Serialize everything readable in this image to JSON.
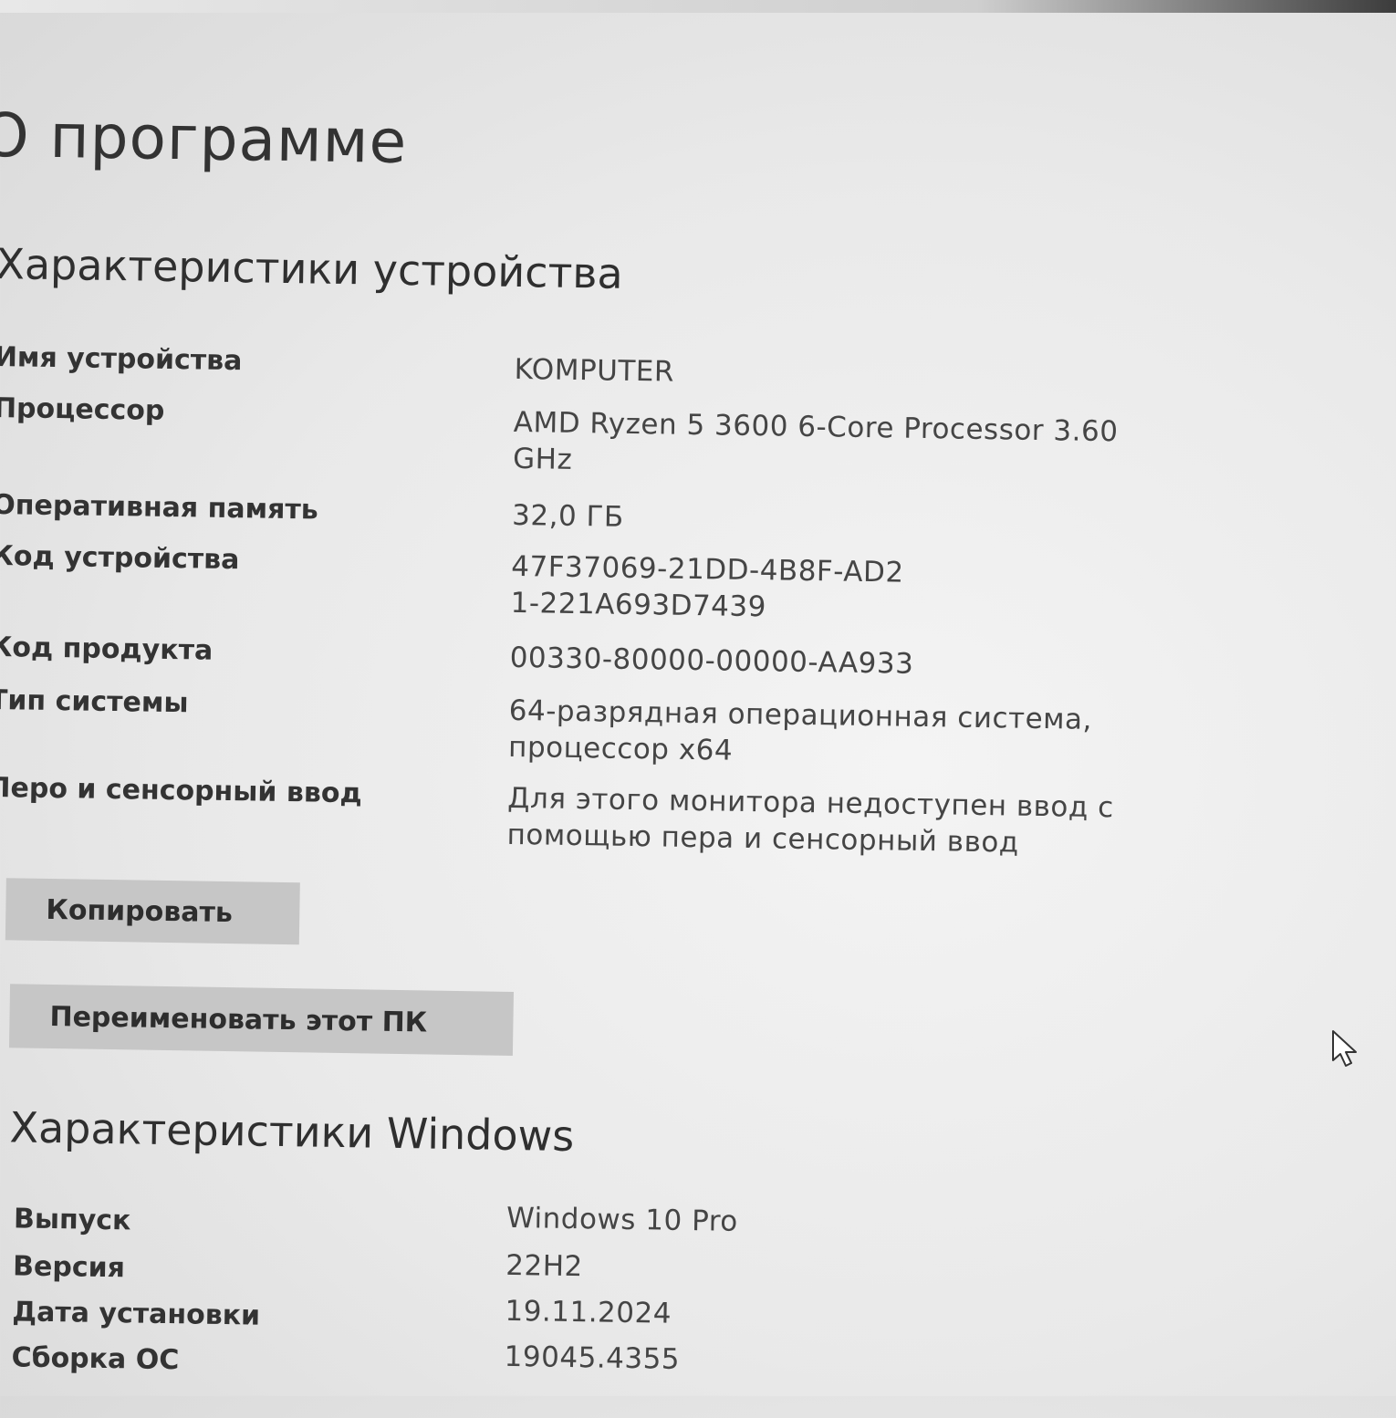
{
  "page": {
    "title": "О программе"
  },
  "device_specs": {
    "title": "Характеристики устройства",
    "rows": [
      {
        "label": "Имя устройства",
        "value": "KOMPUTER"
      },
      {
        "label": "Процессор",
        "value": "AMD Ryzen 5 3600 6-Core Processor 3.60 GHz"
      },
      {
        "label": "Оперативная память",
        "value": "32,0 ГБ"
      },
      {
        "label": "Код устройства",
        "value": "47F37069-21DD-4B8F-AD21-221A693D7439"
      },
      {
        "label": "Код продукта",
        "value": "00330-80000-00000-AA933"
      },
      {
        "label": "Тип системы",
        "value": "64-разрядная операционная система, процессор x64"
      },
      {
        "label": "Перо и сенсорный ввод",
        "value": "Для этого монитора недоступен ввод с помощью пера и сенсорный ввод"
      }
    ],
    "copy_button": "Копировать",
    "rename_button": "Переименовать этот ПК"
  },
  "windows_specs": {
    "title": "Характеристики Windows",
    "rows": [
      {
        "label": "Выпуск",
        "value": "Windows 10 Pro"
      },
      {
        "label": "Версия",
        "value": "22H2"
      },
      {
        "label": "Дата установки",
        "value": "19.11.2024"
      },
      {
        "label": "Сборка ОС",
        "value": "19045.4355"
      }
    ]
  },
  "icons": {
    "cursor": "mouse-pointer-icon"
  },
  "colors": {
    "background": "#ececec",
    "button": "#c6c6c6",
    "text": "#333333"
  }
}
